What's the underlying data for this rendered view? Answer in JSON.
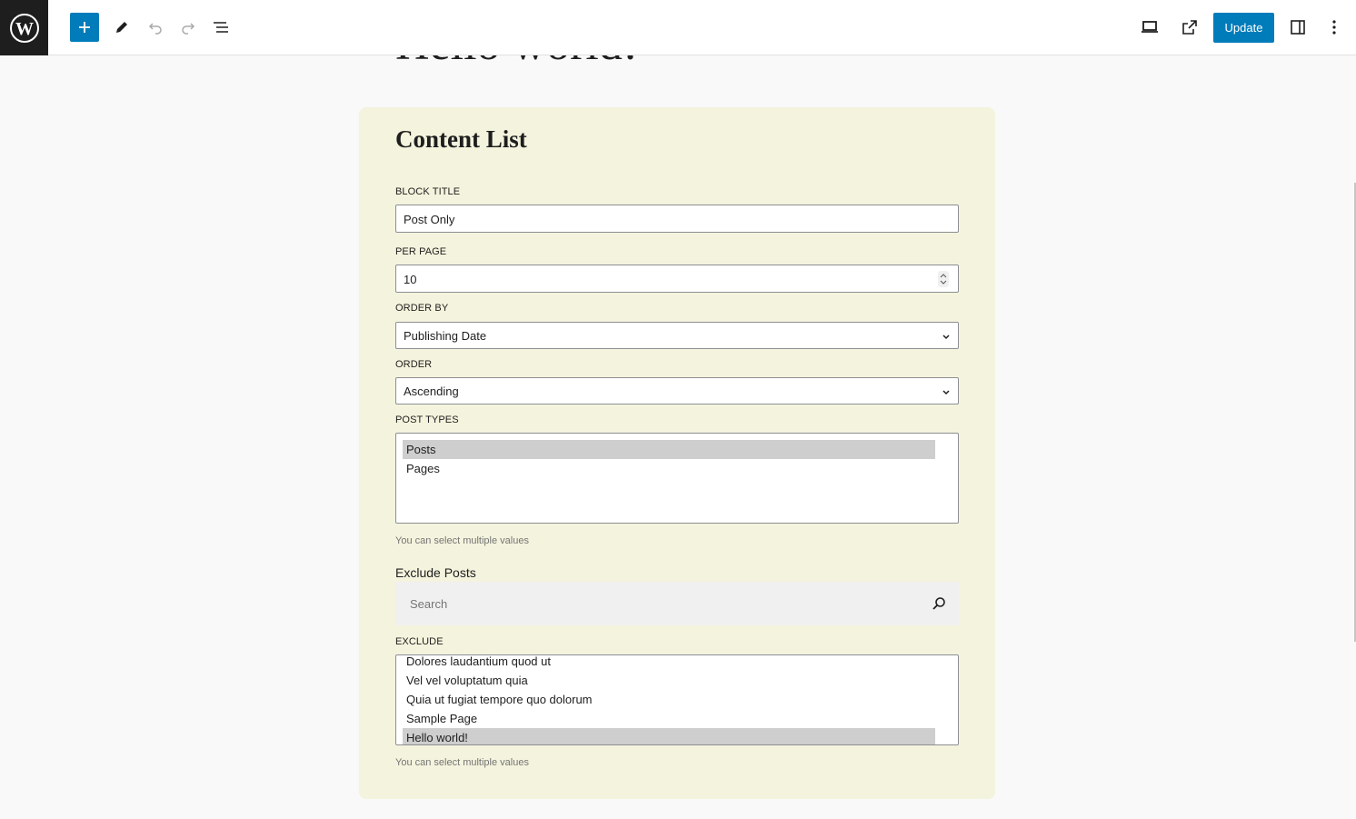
{
  "toolbar": {
    "update_label": "Update"
  },
  "post": {
    "title": "Hello world!"
  },
  "block": {
    "title": "Content List",
    "block_title_label": "BLOCK TITLE",
    "block_title_value": "Post Only",
    "per_page_label": "PER PAGE",
    "per_page_value": "10",
    "order_by_label": "ORDER BY",
    "order_by_value": "Publishing Date",
    "order_label": "ORDER",
    "order_value": "Ascending",
    "post_types_label": "POST TYPES",
    "post_types": [
      {
        "label": "Posts",
        "selected": true
      },
      {
        "label": "Pages",
        "selected": false
      }
    ],
    "post_types_help": "You can select multiple values",
    "exclude_posts_title": "Exclude Posts",
    "search_placeholder": "Search",
    "exclude_label": "EXCLUDE",
    "exclude_items": [
      {
        "label": "Dolores laudantium quod ut",
        "selected": false
      },
      {
        "label": "Vel vel voluptatum quia",
        "selected": false
      },
      {
        "label": "Quia ut fugiat tempore quo dolorum",
        "selected": false
      },
      {
        "label": "Sample Page",
        "selected": false
      },
      {
        "label": "Hello world!",
        "selected": true
      }
    ],
    "exclude_help": "You can select multiple values"
  },
  "colors": {
    "accent": "#007cba",
    "block_bg": "#f4f3dd",
    "topbar_dark": "#1e1e1e"
  },
  "icons": [
    "wordpress-logo-icon",
    "plus-icon",
    "pencil-icon",
    "undo-icon",
    "redo-icon",
    "list-view-icon",
    "desktop-preview-icon",
    "external-link-icon",
    "sidebar-toggle-icon",
    "more-vertical-icon",
    "search-icon",
    "chevron-down-icon"
  ]
}
